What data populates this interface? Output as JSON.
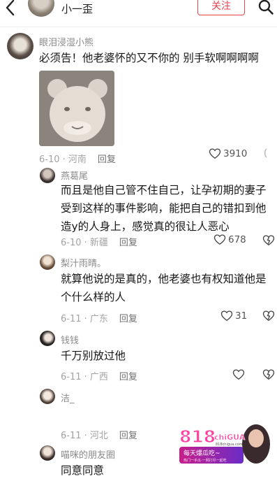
{
  "header": {
    "back_icon": "chevron-left-icon",
    "title": "小一歪",
    "follow_label": "关注",
    "search_icon": "search-icon",
    "accent": "#e8434f"
  },
  "comments": [
    {
      "user": "眼泪浸湿小熊",
      "text": "必须告！他老婆怀的又不你的 别手软啊啊啊啊",
      "meta": "6-10 · 河南",
      "reply": "回复",
      "likes": "3910",
      "has_image": true
    },
    {
      "user": "燕葛尾",
      "text_lines": [
        "而且是他自己管不住自己，让孕初期的妻子",
        "受到这样的事件影响，能把自己的错扣到他",
        "造y的人身上，感觉真的很让人恶心"
      ],
      "meta": "6-10 · 新疆",
      "reply": "回复",
      "likes": "678"
    },
    {
      "user": "梨汁雨晴。",
      "text_lines": [
        "就算他说的是真的，他老婆也有权知道他是",
        "个什么样的人"
      ],
      "meta": "6-11 · 广东",
      "reply": "回复",
      "likes": "31"
    },
    {
      "user": "钱钱",
      "text": "千万别放过他",
      "meta": "6-11 · 广西",
      "reply": "回复"
    },
    {
      "user": "洁_",
      "text": "",
      "meta": "6-11 · 河北",
      "reply": "回复"
    },
    {
      "user": "喵咪的朋友圈",
      "text": "同意同意"
    }
  ],
  "watermark": {
    "brand": "818",
    "brand_sub": "chiGUA",
    "url": "818chigua.com",
    "slogan": "每天爆瓜吃~",
    "tagline": "热门一手瓜·一网打尽一起吃"
  }
}
